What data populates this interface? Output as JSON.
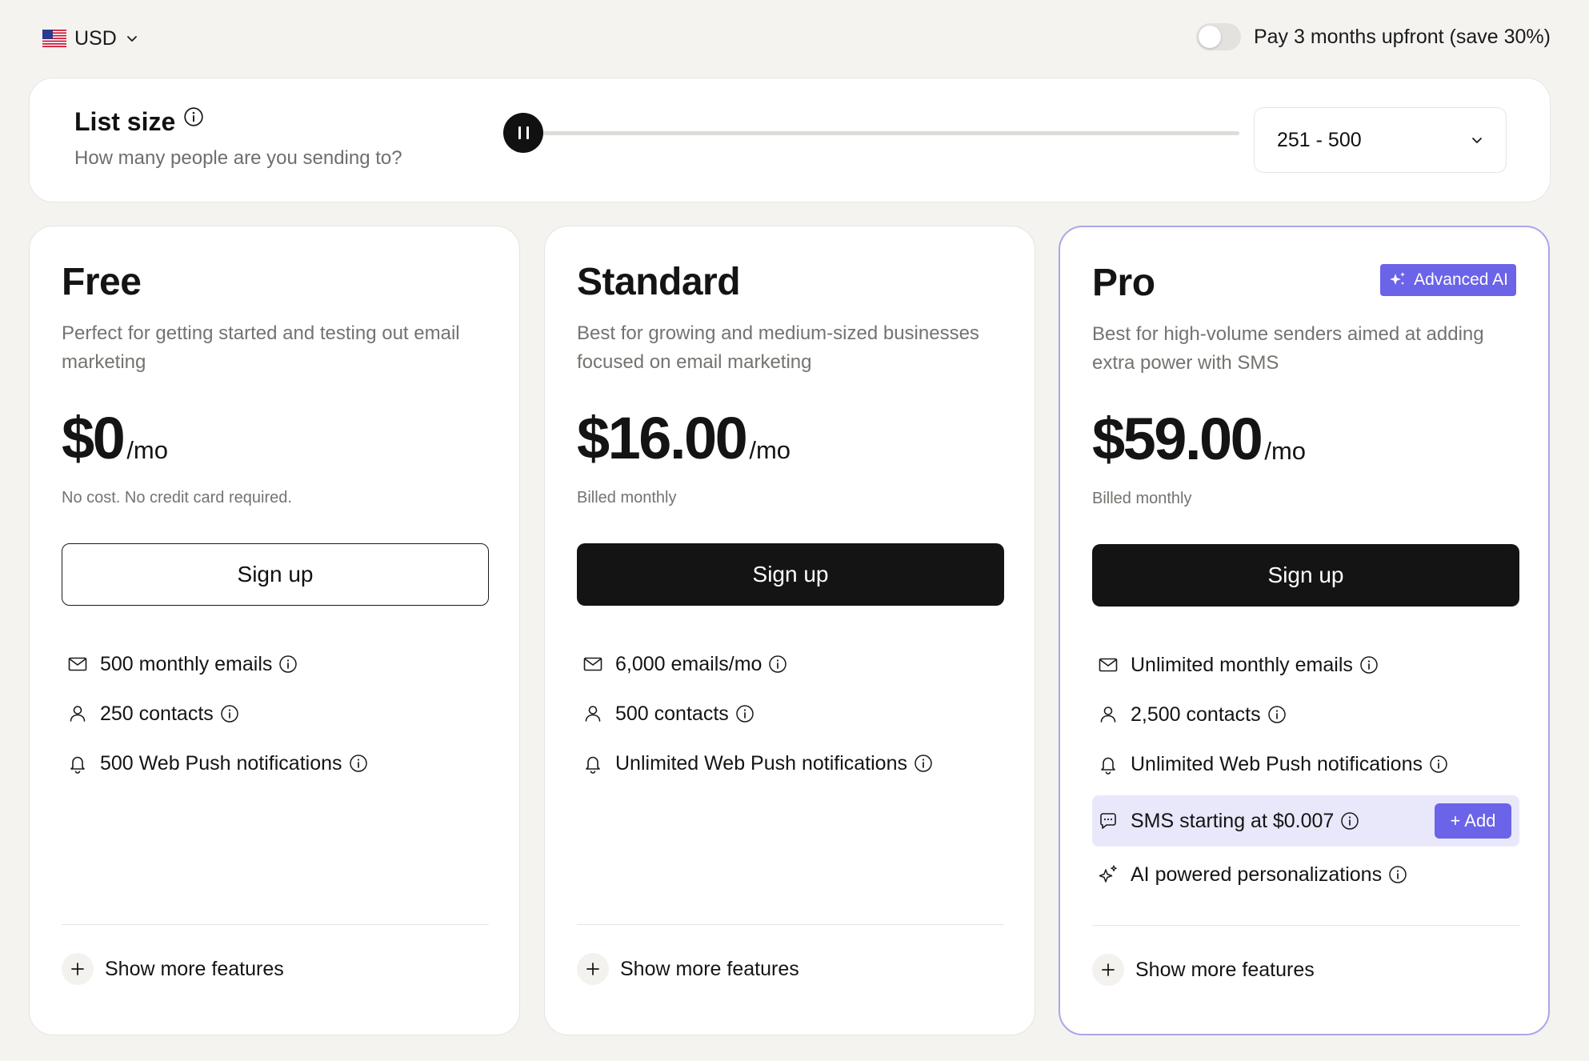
{
  "top": {
    "currency": "USD",
    "billing_toggle_label": "Pay 3 months upfront (save 30%)",
    "billing_toggle_on": false
  },
  "list_size": {
    "title": "List size",
    "subtitle": "How many people are you sending to?",
    "slider_fraction": 0.04,
    "selected_range": "251 - 500"
  },
  "plans": [
    {
      "name": "Free",
      "description": "Perfect for getting started and testing out email marketing",
      "price": "$0",
      "period": "/mo",
      "billing_note": "No cost. No credit card required.",
      "cta": "Sign up",
      "features": [
        {
          "icon": "mail-icon",
          "text": "500 monthly emails"
        },
        {
          "icon": "user-icon",
          "text": "250 contacts"
        },
        {
          "icon": "bell-icon",
          "text": "500 Web Push notifications"
        }
      ],
      "show_more": "Show more features"
    },
    {
      "name": "Standard",
      "description": "Best for growing and medium-sized businesses focused on email marketing",
      "price": "$16.00",
      "period": "/mo",
      "billing_note": "Billed monthly",
      "cta": "Sign up",
      "features": [
        {
          "icon": "mail-icon",
          "text": "6,000 emails/mo"
        },
        {
          "icon": "user-icon",
          "text": "500 contacts"
        },
        {
          "icon": "bell-icon",
          "text": "Unlimited Web Push notifications"
        }
      ],
      "show_more": "Show more features"
    },
    {
      "name": "Pro",
      "badge": "Advanced AI",
      "description": "Best for high-volume senders aimed at adding extra power with SMS",
      "price": "$59.00",
      "period": "/mo",
      "billing_note": "Billed monthly",
      "cta": "Sign up",
      "features": [
        {
          "icon": "mail-icon",
          "text": "Unlimited monthly emails"
        },
        {
          "icon": "user-icon",
          "text": "2,500 contacts"
        },
        {
          "icon": "bell-icon",
          "text": "Unlimited Web Push notifications"
        },
        {
          "icon": "message-icon",
          "text": "SMS starting at $0.007",
          "add_label": "+ Add"
        },
        {
          "icon": "sparkle-icon",
          "text": "AI powered personalizations"
        }
      ],
      "show_more": "Show more features"
    }
  ],
  "colors": {
    "accent": "#6b63e8",
    "sms_highlight": "#e9e8fb",
    "pro_border": "#a9a6ea",
    "dark_button": "#141414",
    "background": "#f4f3f0"
  }
}
